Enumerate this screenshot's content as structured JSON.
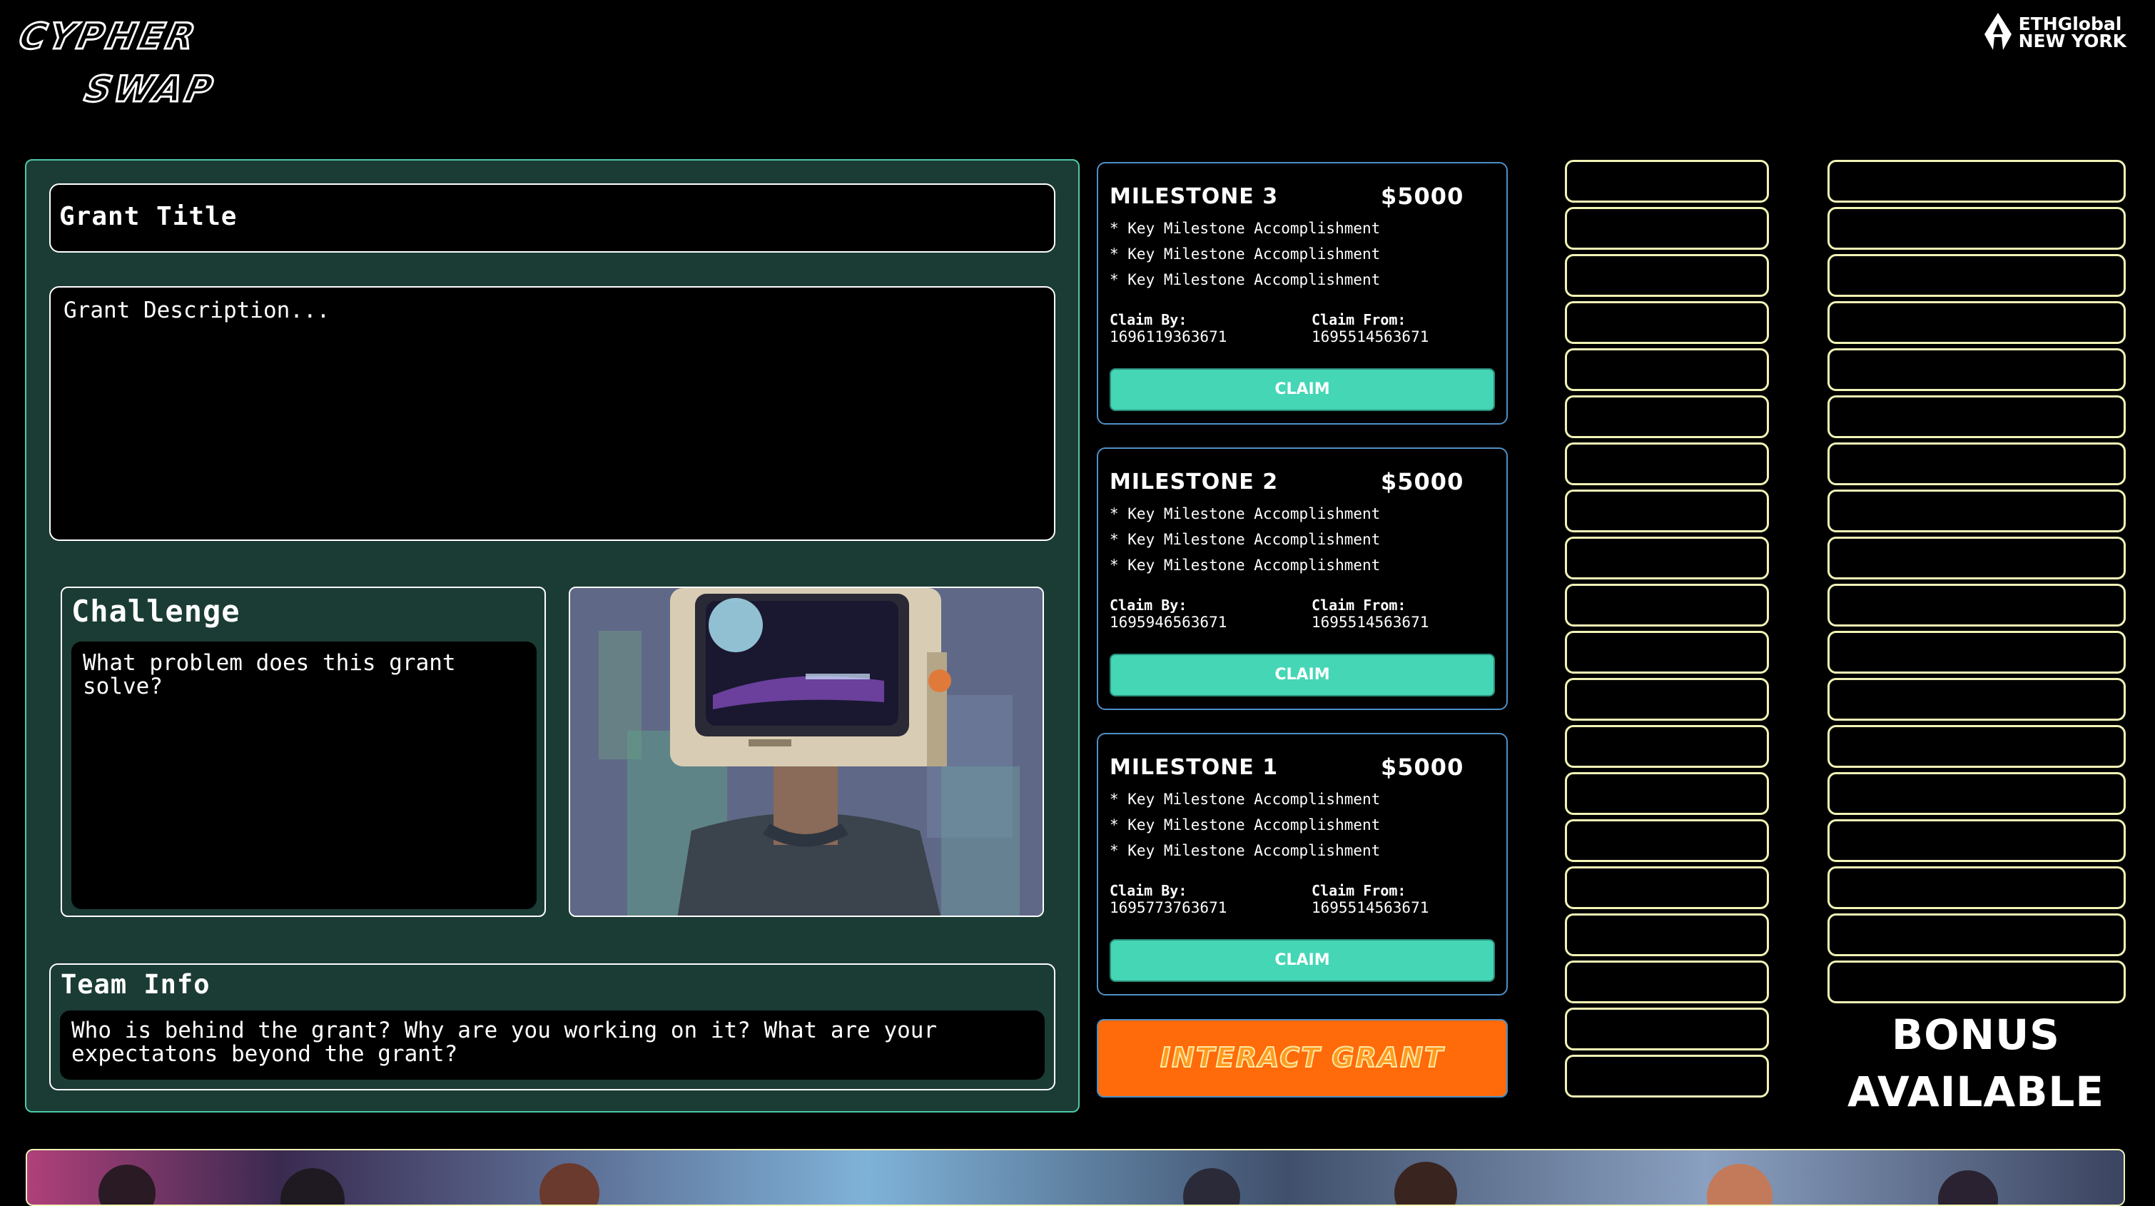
{
  "logo": {
    "line1": "CYPHER",
    "line2": "SWAP"
  },
  "partner": {
    "line1": "ETHGlobal",
    "line2": "NEW YORK",
    "icon": "ethglobal-logo-icon"
  },
  "grant": {
    "title_placeholder": "Grant Title",
    "description_placeholder": "Grant Description..."
  },
  "challenge": {
    "title": "Challenge",
    "text": "What problem does this grant solve?"
  },
  "team": {
    "title": "Team Info",
    "text": "Who is behind the grant? Why are you working on it? What are your expectatons beyond the grant?"
  },
  "milestones": [
    {
      "title": "MILESTONE 3",
      "amount": "$5000",
      "bullets": [
        "* Key Milestone Accomplishment",
        "* Key Milestone Accomplishment",
        "* Key Milestone Accomplishment"
      ],
      "claim_by_label": "Claim By:",
      "claim_by": "1696119363671",
      "claim_from_label": "Claim From:",
      "claim_from": "1695514563671",
      "button": "CLAIM"
    },
    {
      "title": "MILESTONE 2",
      "amount": "$5000",
      "bullets": [
        "* Key Milestone Accomplishment",
        "* Key Milestone Accomplishment",
        "* Key Milestone Accomplishment"
      ],
      "claim_by_label": "Claim By:",
      "claim_by": "1695946563671",
      "claim_from_label": "Claim From:",
      "claim_from": "1695514563671",
      "button": "CLAIM"
    },
    {
      "title": "MILESTONE 1",
      "amount": "$5000",
      "bullets": [
        "* Key Milestone Accomplishment",
        "* Key Milestone Accomplishment",
        "* Key Milestone Accomplishment"
      ],
      "claim_by_label": "Claim By:",
      "claim_by": "1695773763671",
      "claim_from_label": "Claim From:",
      "claim_from": "1695514563671",
      "button": "CLAIM"
    }
  ],
  "interact_button": "INTERACT GRANT",
  "bonus": {
    "line1": "BONUS",
    "line2": "AVAILABLE"
  },
  "colors": {
    "panel": "#1b3c34",
    "accent": "#45d6b6",
    "orange": "#ff6a0a",
    "slot_border": "#f1f3b5"
  }
}
